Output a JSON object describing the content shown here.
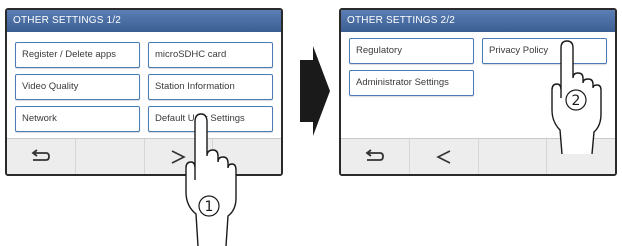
{
  "screen1": {
    "title": "OTHER SETTINGS 1/2",
    "buttons": [
      "Register / Delete apps",
      "microSDHC card",
      "Video Quality",
      "Station Information",
      "Network",
      "Default User Settings"
    ],
    "nav": [
      "back-icon",
      "",
      "next-icon",
      ""
    ]
  },
  "screen2": {
    "title": "OTHER SETTINGS 2/2",
    "buttons": [
      "Regulatory",
      "Privacy Policy",
      "Administrator Settings"
    ],
    "nav": [
      "back-icon",
      "previous-icon",
      "",
      ""
    ]
  },
  "callouts": {
    "step1": "1",
    "step2": "2"
  },
  "colors": {
    "titlebar": "#3b5e92",
    "button_border": "#4a7bb8",
    "screen_frame": "#2a2a2a",
    "arrow": "#1a1a1a"
  }
}
